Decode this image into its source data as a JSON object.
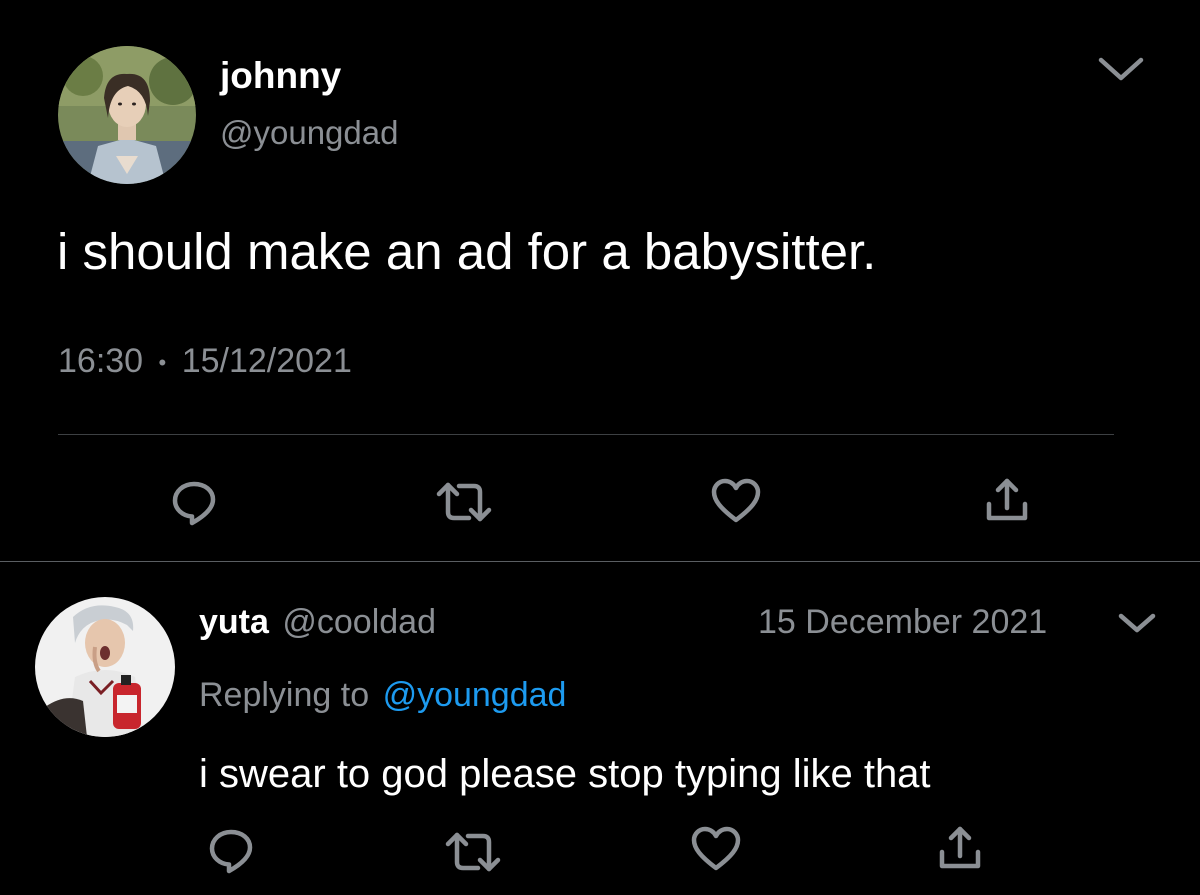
{
  "main_tweet": {
    "display_name": "johnny",
    "handle": "@youngdad",
    "text": "i should make an ad for a babysitter.",
    "time": "16:30",
    "separator": "•",
    "date": "15/12/2021",
    "actions": [
      "reply-icon",
      "retweet-icon",
      "like-icon",
      "share-icon"
    ]
  },
  "reply_tweet": {
    "display_name": "yuta",
    "handle": "@cooldad",
    "date": "15 December 2021",
    "replying_prefix": "Replying to",
    "replying_handle": "@youngdad",
    "text": "i swear to god please stop typing like that",
    "actions": [
      "reply-icon",
      "retweet-icon",
      "like-icon",
      "share-icon"
    ]
  },
  "colors": {
    "background": "#000000",
    "text": "#ffffff",
    "muted": "#8b8f94",
    "link": "#1d9bf0",
    "divider": "#3d4043"
  }
}
